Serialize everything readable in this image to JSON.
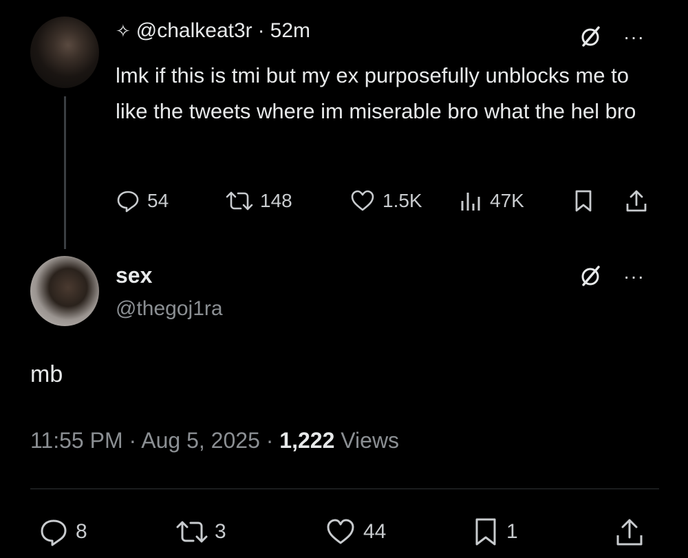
{
  "tweet": {
    "author_handle": "@chalkeat3r",
    "separator": "·",
    "time_ago": "52m",
    "text": "lmk if this is tmi but my ex purposefully unblocks me to like the tweets where im miserable bro what the hel bro",
    "actions": {
      "replies": "54",
      "retweets": "148",
      "likes": "1.5K",
      "views": "47K"
    }
  },
  "reply": {
    "display_name": "sex",
    "handle": "@thegoj1ra",
    "text": "mb",
    "time": "11:55 PM",
    "separator": "·",
    "date": "Aug 5, 2025",
    "views_count": "1,222",
    "views_label": "Views",
    "actions": {
      "replies": "8",
      "retweets": "3",
      "likes": "44",
      "bookmarks": "1"
    }
  },
  "icons": {
    "sparkle": "✧",
    "more": "···"
  },
  "colors": {
    "background": "#000000",
    "text": "#e7e9ea",
    "secondary": "#8b8f93",
    "divider": "#2f3336"
  }
}
